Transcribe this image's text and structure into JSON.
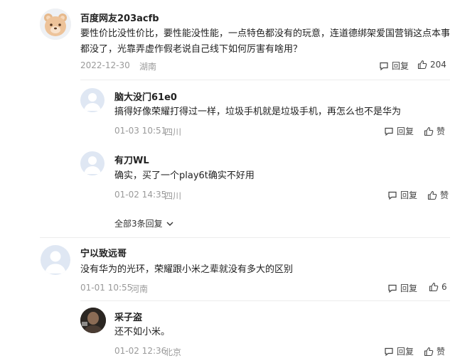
{
  "comments": [
    {
      "user": "百度网友203acfb",
      "text": "要性价比没性价比，要性能没性能，一点特色都没有的玩意，连道德绑架爱国营销这点本事都没了，光靠弄虚作假老说自己线下如何厉害有啥用？",
      "date": "2022-12-30",
      "location": "湖南",
      "reply_label": "回复",
      "like_count": "204",
      "avatar": "bear-avatar"
    },
    {
      "user": "脑大没门61e0",
      "text": "搞得好像荣耀打得过一样，垃圾手机就是垃圾手机，再怎么也不是华为",
      "date": "01-03 10:51",
      "location": "四川",
      "reply_label": "回复",
      "like_count": "赞",
      "avatar": "default-avatar"
    },
    {
      "user": "有刀WL",
      "text": "确实，买了一个play6t确实不好用",
      "date": "01-02 14:35",
      "location": "四川",
      "reply_label": "回复",
      "like_count": "赞",
      "avatar": "default-avatar"
    },
    {
      "user": "宁以致远哥",
      "text": "没有华为的光环，荣耀跟小米之辈就没有多大的区别",
      "date": "01-01 10:55",
      "location": "河南",
      "reply_label": "回复",
      "like_count": "6",
      "avatar": "default-avatar"
    },
    {
      "user": "采子盗",
      "text": "还不如小米。",
      "date": "01-02 12:36",
      "location": "北京",
      "reply_label": "回复",
      "like_count": "赞",
      "avatar": "dark-photo-avatar"
    }
  ],
  "all_replies_label": "全部3条回复"
}
